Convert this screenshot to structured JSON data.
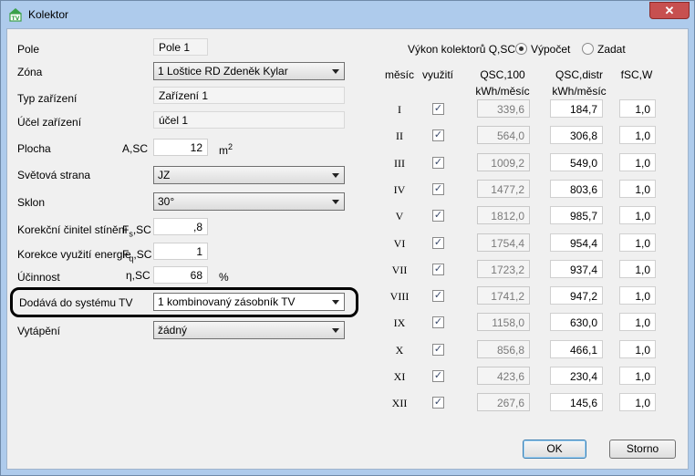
{
  "window": {
    "title": "Kolektor",
    "close_symbol": "✕",
    "icon": "tv-house-icon",
    "icon_text": "TV"
  },
  "form": {
    "pole": {
      "label": "Pole",
      "value": "Pole 1"
    },
    "zona": {
      "label": "Zóna",
      "value": "1 Loštice RD Zdeněk Kylar"
    },
    "typ": {
      "label": "Typ zařízení",
      "value": "Zařízení 1"
    },
    "ucel": {
      "label": "Účel zařízení",
      "value": "účel 1"
    },
    "plocha": {
      "label": "Plocha",
      "symbol": "A,SC",
      "value": "12",
      "unit": "m",
      "unit_sup": "2"
    },
    "strana": {
      "label": "Světová strana",
      "value": "JZ"
    },
    "sklon": {
      "label": "Sklon",
      "value": "30°"
    },
    "stineni": {
      "label": "Korekční činitel stínění",
      "symbol_main": "F",
      "symbol_sub": "s",
      "symbol_rest": ",SC",
      "value": ",8"
    },
    "vyuziti": {
      "label": "Korekce využití energie",
      "symbol_main": "F",
      "symbol_sub": "q",
      "symbol_rest": ",SC",
      "value": "1"
    },
    "ucinnost": {
      "label": "Účinnost",
      "symbol": "η,SC",
      "value": "68",
      "unit": "%"
    },
    "dodava": {
      "label": "Dodává do systému TV",
      "value": "1 kombinovaný zásobník TV"
    },
    "vytapeni": {
      "label": "Vytápění",
      "value": "žádný"
    }
  },
  "vykon": {
    "label": "Výkon kolektorů Q,SC",
    "options": [
      {
        "label": "Výpočet",
        "selected": true
      },
      {
        "label": "Zadat",
        "selected": false
      }
    ]
  },
  "table": {
    "headers": {
      "mesic": "měsíc",
      "vyuziti": "využití",
      "qsc100": "QSC,100",
      "qsc100_unit": "kWh/měsíc",
      "qscdistr": "QSC,distr",
      "qscdistr_unit": "kWh/měsíc",
      "fsc": "fSC,W"
    },
    "rows": [
      {
        "month": "I",
        "checked": true,
        "q100": "339,6",
        "qdistr": "184,7",
        "f": "1,0"
      },
      {
        "month": "II",
        "checked": true,
        "q100": "564,0",
        "qdistr": "306,8",
        "f": "1,0"
      },
      {
        "month": "III",
        "checked": true,
        "q100": "1009,2",
        "qdistr": "549,0",
        "f": "1,0"
      },
      {
        "month": "IV",
        "checked": true,
        "q100": "1477,2",
        "qdistr": "803,6",
        "f": "1,0"
      },
      {
        "month": "V",
        "checked": true,
        "q100": "1812,0",
        "qdistr": "985,7",
        "f": "1,0"
      },
      {
        "month": "VI",
        "checked": true,
        "q100": "1754,4",
        "qdistr": "954,4",
        "f": "1,0"
      },
      {
        "month": "VII",
        "checked": true,
        "q100": "1723,2",
        "qdistr": "937,4",
        "f": "1,0"
      },
      {
        "month": "VIII",
        "checked": true,
        "q100": "1741,2",
        "qdistr": "947,2",
        "f": "1,0"
      },
      {
        "month": "IX",
        "checked": true,
        "q100": "1158,0",
        "qdistr": "630,0",
        "f": "1,0"
      },
      {
        "month": "X",
        "checked": true,
        "q100": "856,8",
        "qdistr": "466,1",
        "f": "1,0"
      },
      {
        "month": "XI",
        "checked": true,
        "q100": "423,6",
        "qdistr": "230,4",
        "f": "1,0"
      },
      {
        "month": "XII",
        "checked": true,
        "q100": "267,6",
        "qdistr": "145,6",
        "f": "1,0"
      }
    ]
  },
  "buttons": {
    "ok": "OK",
    "storno": "Storno"
  },
  "colors": {
    "titlebar": "#aecbec",
    "close": "#c75050",
    "highlight_border": "#000000"
  }
}
